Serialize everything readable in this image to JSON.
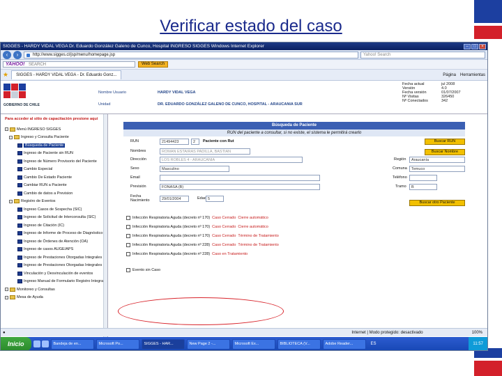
{
  "slide": {
    "title": "Verificar estado del caso"
  },
  "colors": {
    "accent": "#1a2a8c",
    "flag_blue": "#1c3fa0",
    "flag_red": "#d3202a",
    "highlight": "#d8232a",
    "button_yellow": "#f2c000"
  },
  "browser": {
    "window_title": "SIGGES - HARDY VIDAL VEGA   Dr. Eduardo González Galeno de Cunco, Hospital   INGRESO SIGGES   Windows Internet Explorer",
    "url": "http://www.sigges.cl/jsp/menu/homepage.jsp",
    "live_search_placeholder": "Yahoo! Search",
    "yahoo_logo": "YAHOO!",
    "yahoo_search_placeholder": "SEARCH",
    "web_search_label": "Web Search",
    "tab_label": "SIGGES - HARDY VIDAL VEGA - Dr. Eduardo Gonz...",
    "tools": [
      "Página",
      "Herramientas"
    ],
    "status_internet": "Internet | Modo protegido: desactivado",
    "zoom": "100%"
  },
  "header": {
    "logo_caption": "GOBIERNO DE CHILE",
    "user_label": "Nombre Usuario",
    "user_value": "HARDY VIDAL VEGA",
    "unit_label": "Unidad",
    "unit_value": "DR. EDUARDO GONZÁLEZ GALENO DE CUNCO, HOSPITAL - ARAUCANIA SUR",
    "stats": [
      {
        "k": "Fecha actual",
        "v": "jul 2008"
      },
      {
        "k": "Versión",
        "v": "4.0"
      },
      {
        "k": "Fecha versión",
        "v": "01/07/2007"
      },
      {
        "k": "Nº Visitas",
        "v": "326450"
      },
      {
        "k": "Nº Conectados",
        "v": "342"
      }
    ]
  },
  "sidebar": {
    "note": "Para acceder al sitio de capacitación presione aquí",
    "items": [
      {
        "label": "Menú INGRESO SIGGES",
        "level": 0,
        "type": "folder"
      },
      {
        "label": "Ingreso y Consulta Paciente",
        "level": 1,
        "type": "folder"
      },
      {
        "label": "Búsqueda de Paciente",
        "level": 2,
        "type": "doc",
        "selected": true
      },
      {
        "label": "Ingreso de Paciente sin RUN",
        "level": 2,
        "type": "doc"
      },
      {
        "label": "Ingreso de Número Provisorio del Paciente",
        "level": 2,
        "type": "doc"
      },
      {
        "label": "Cambio Especial",
        "level": 2,
        "type": "doc"
      },
      {
        "label": "Cambio De Estado Paciente",
        "level": 2,
        "type": "doc"
      },
      {
        "label": "Cambiar RUN a Paciente",
        "level": 2,
        "type": "doc"
      },
      {
        "label": "Cambio de datos a Prevision",
        "level": 2,
        "type": "doc"
      },
      {
        "label": "Registro de Eventos",
        "level": 1,
        "type": "folder"
      },
      {
        "label": "Ingreso Casos de Sospecha (SIC)",
        "level": 2,
        "type": "doc"
      },
      {
        "label": "Ingreso de Solicitud de Interconsulta (SIC)",
        "level": 2,
        "type": "doc"
      },
      {
        "label": "Ingreso de Citación (IC)",
        "level": 2,
        "type": "doc"
      },
      {
        "label": "Ingreso de Informe de Proceso de Diagnóstico",
        "level": 2,
        "type": "doc"
      },
      {
        "label": "Ingreso de Órdenes de Atención (OA)",
        "level": 2,
        "type": "doc"
      },
      {
        "label": "Ingreso de casos AUGE/APS",
        "level": 2,
        "type": "doc"
      },
      {
        "label": "Ingreso de Prestaciones Otorgadas Integrales",
        "level": 2,
        "type": "doc"
      },
      {
        "label": "Ingreso de Prestaciones Otorgadas Integrales",
        "level": 2,
        "type": "doc"
      },
      {
        "label": "Vinculación y Desvinculación de eventos",
        "level": 2,
        "type": "doc"
      },
      {
        "label": "Ingreso Manual de Formulario Registro Integral",
        "level": 2,
        "type": "doc"
      },
      {
        "label": "Monitoreo y Consultas",
        "level": 0,
        "type": "folder"
      },
      {
        "label": "Mesa de Ayuda",
        "level": 0,
        "type": "folder"
      }
    ]
  },
  "form": {
    "title": "Búsqueda de Paciente",
    "subtitle": "RUN del paciente a consultar, si no existe, el sistema le permitirá crearlo",
    "run_label": "RUN",
    "run_value": "21494423",
    "run_dv": "2",
    "run_result": "Paciente con Rut",
    "search_button": "Buscar RUN",
    "name_label": "Nombres",
    "name_value": "ROMAN ESTAIRAS PADILLA, BASTIAN",
    "name_button": "Buscar Nombre",
    "address_label": "Dirección",
    "address_value": "LOS ROBLES 4 - ARAUCANIA",
    "region_label": "Región",
    "region_value": "Araucanía",
    "sex_label": "Sexo",
    "sex_value": "Masculino",
    "comuna_label": "Comuna",
    "comuna_value": "Temuco",
    "email_label": "Email",
    "phone_label": "Teléfono",
    "prevision_label": "Previsión",
    "prevision_value": "FONASA (B)",
    "tramo_label": "Tramo",
    "tramo_value": "B",
    "birth_label": "Fecha Nacimiento",
    "birth_value": "29/01/2004",
    "age_label": "Edad",
    "age_value": "5",
    "other_patient_button": "Buscar otro Paciente",
    "cases": [
      {
        "prefix": "Infección Respiratoria Aguda (decreto nº 170)",
        "status": "Caso Cerrado",
        "reason": "Cierre automático"
      },
      {
        "prefix": "Infección Respiratoria Aguda (decreto nº 170)",
        "status": "Caso Cerrado",
        "reason": "Cierre automático"
      },
      {
        "prefix": "Infección Respiratoria Aguda (decreto nº 170)",
        "status": "Caso Cerrado",
        "reason": "Término de Tratamiento"
      },
      {
        "prefix": "Infección Respiratoria Aguda (decreto nº 228)",
        "status": "Caso Cerrado",
        "reason": "Término de Tratamiento"
      },
      {
        "prefix": "Infección Respiratoria Aguda (decreto nº 228)",
        "status": "Caso en Tratamiento",
        "reason": ""
      }
    ],
    "new_event_label": "Evento sin Caso"
  },
  "taskbar": {
    "start": "Inicio",
    "tasks": [
      "Bandeja de en...",
      "Microsoft Po...",
      "SIGGES - HAR...",
      "New Page 2 -...",
      "Microsoft Ex...",
      "BIBLIOTECA (V...",
      "Adobe Reader..."
    ],
    "lang": "ES",
    "clock": "11:57"
  }
}
